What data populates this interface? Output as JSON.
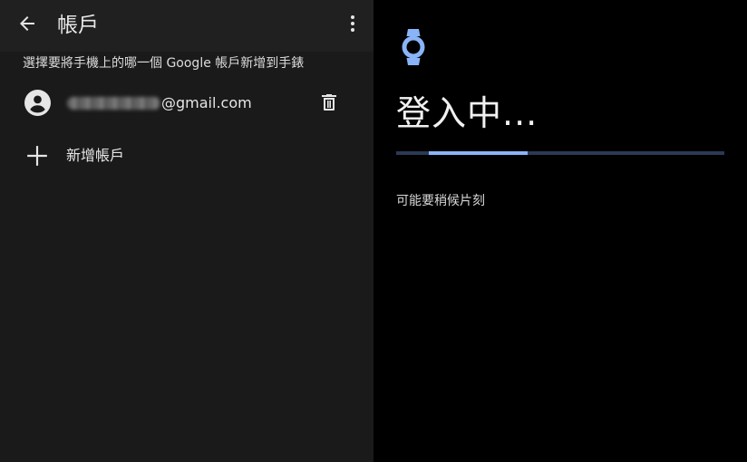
{
  "header": {
    "title": "帳戶",
    "back_icon": "arrow-back-icon",
    "more_icon": "more-vert-icon"
  },
  "subtitle": "選擇要將手機上的哪一個 Google 帳戶新增到手錶",
  "account": {
    "email_domain": "@gmail.com",
    "avatar_icon": "account-circle-icon",
    "delete_icon": "trash-icon"
  },
  "add_account": {
    "label": "新增帳戶",
    "icon": "plus-icon"
  },
  "signin": {
    "watch_icon": "watch-icon",
    "title": "登入中...",
    "progress": {
      "segment_start": 0.1,
      "segment_end": 0.4
    },
    "message": "可能要稍候片刻"
  },
  "colors": {
    "accent": "#8ab4f8",
    "left_background": "#1a1a1a",
    "right_background": "#000000",
    "text": "#e6e6e6"
  }
}
